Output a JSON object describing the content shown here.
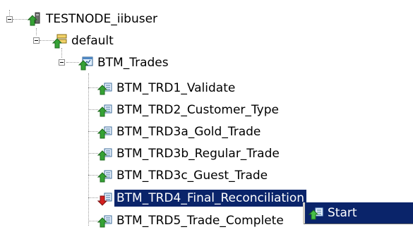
{
  "tree": {
    "root": {
      "label": "TESTNODE_iibuser",
      "icon": "integration-node-icon"
    },
    "server": {
      "label": "default",
      "icon": "integration-server-icon"
    },
    "application": {
      "label": "BTM_Trades",
      "icon": "application-icon"
    },
    "flows": [
      {
        "label": "BTM_TRD1_Validate",
        "icon": "message-flow-running-icon",
        "state": "running"
      },
      {
        "label": "BTM_TRD2_Customer_Type",
        "icon": "message-flow-running-icon",
        "state": "running"
      },
      {
        "label": "BTM_TRD3a_Gold_Trade",
        "icon": "message-flow-running-icon",
        "state": "running"
      },
      {
        "label": "BTM_TRD3b_Regular_Trade",
        "icon": "message-flow-running-icon",
        "state": "running"
      },
      {
        "label": "BTM_TRD3c_Guest_Trade",
        "icon": "message-flow-running-icon",
        "state": "running"
      },
      {
        "label": "BTM_TRD4_Final_Reconciliation",
        "icon": "message-flow-stopped-icon",
        "state": "stopped",
        "selected": true
      },
      {
        "label": "BTM_TRD5_Trade_Complete",
        "icon": "message-flow-running-icon",
        "state": "running"
      }
    ]
  },
  "context_menu": {
    "start_label": "Start",
    "start_icon": "start-flow-icon"
  },
  "colors": {
    "selection": "#0a246a",
    "running_arrow": "#2f9e2f",
    "stopped_arrow": "#d42020"
  }
}
